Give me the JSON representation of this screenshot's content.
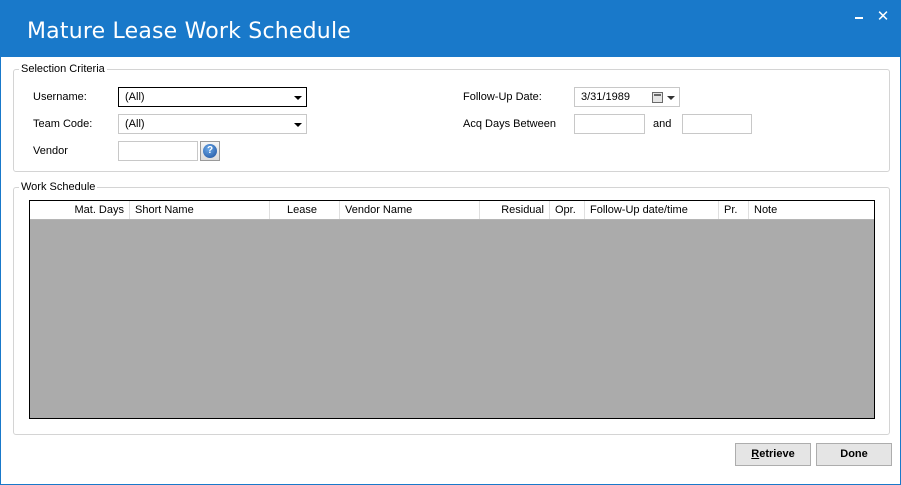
{
  "window": {
    "title": "Mature Lease Work Schedule",
    "close_glyph": "✕"
  },
  "selection_criteria": {
    "legend": "Selection Criteria",
    "username_label": "Username:",
    "username_value": "(All)",
    "team_code_label": "Team Code:",
    "team_code_value": "(All)",
    "vendor_label": "Vendor",
    "vendor_value": "",
    "help_glyph": "?",
    "follow_up_label": "Follow-Up Date:",
    "follow_up_value": "3/31/1989",
    "acq_days_label": "Acq Days Between",
    "acq_from_value": "",
    "and_label": "and",
    "acq_to_value": ""
  },
  "work_schedule": {
    "legend": "Work Schedule",
    "columns": [
      "Mat. Days",
      "Short Name",
      "Lease",
      "Vendor Name",
      "Residual",
      "Opr.",
      "Follow-Up date/time",
      "Pr.",
      "Note"
    ]
  },
  "actions": {
    "retrieve_prefix": "R",
    "retrieve_rest": "etrieve",
    "done_label": "Done"
  },
  "colors": {
    "titlebar": "#1979ca",
    "grid_background": "#ababab"
  },
  "icons": {
    "minimize": "minimize-icon",
    "close": "close-icon",
    "calendar": "calendar-icon",
    "help": "help-icon",
    "dropdown": "chevron-down-icon"
  }
}
